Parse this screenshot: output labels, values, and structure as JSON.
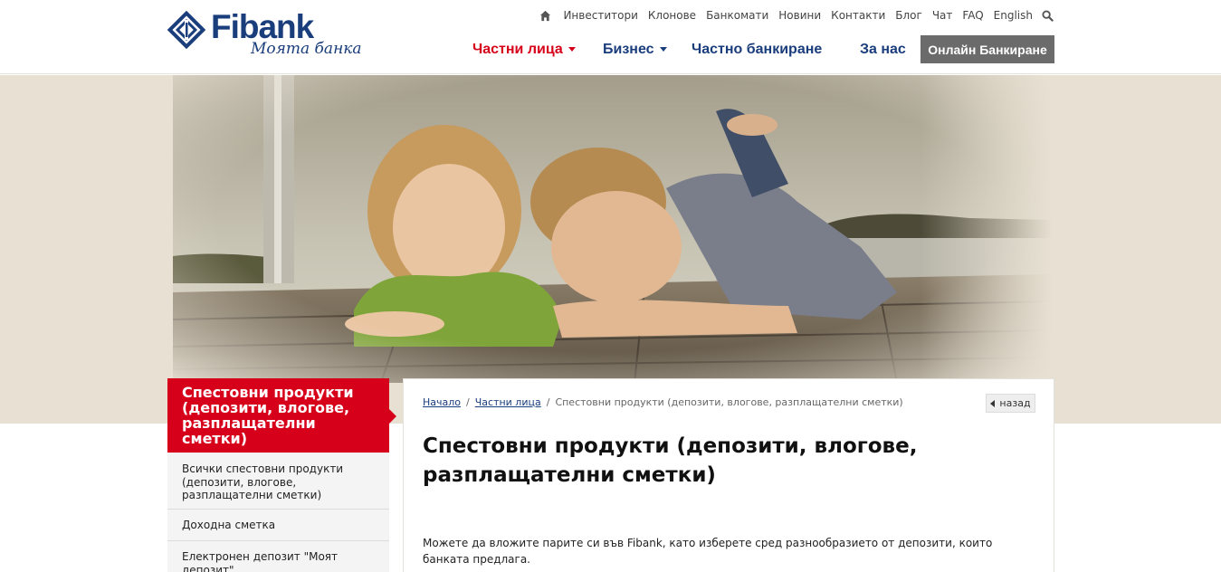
{
  "brand": {
    "name": "Fibank",
    "tagline": "Моята банка",
    "blue": "#1a3d7c",
    "red": "#d7001a"
  },
  "top_links": [
    "Инвеститори",
    "Клонове",
    "Банкомати",
    "Новини",
    "Контакти",
    "Блог",
    "Чат",
    "FAQ",
    "English"
  ],
  "main_nav": {
    "private": "Частни лица",
    "business": "Бизнес",
    "private_banking": "Частно банкиране",
    "about": "За нас",
    "online_banking": "Онлайн Банкиране"
  },
  "sidebar": {
    "heading": "Спестовни продукти (депозити, влогове, разплащателни сметки)",
    "items": [
      "Всички спестовни продукти (депозити, влогове, разплащателни сметки)",
      "Доходна сметка",
      "Електронен депозит \"Моят депозит\""
    ]
  },
  "breadcrumb": {
    "home": "Начало",
    "private": "Частни лица",
    "current": "Спестовни продукти (депозити, влогове, разплащателни сметки)"
  },
  "back_label": "назад",
  "page_title": "Спестовни продукти (депозити, влогове, разплащателни сметки)",
  "intro": "Можете да вложите парите си във Fibank, като изберете сред разнообразието от депозити, които банката предлага."
}
